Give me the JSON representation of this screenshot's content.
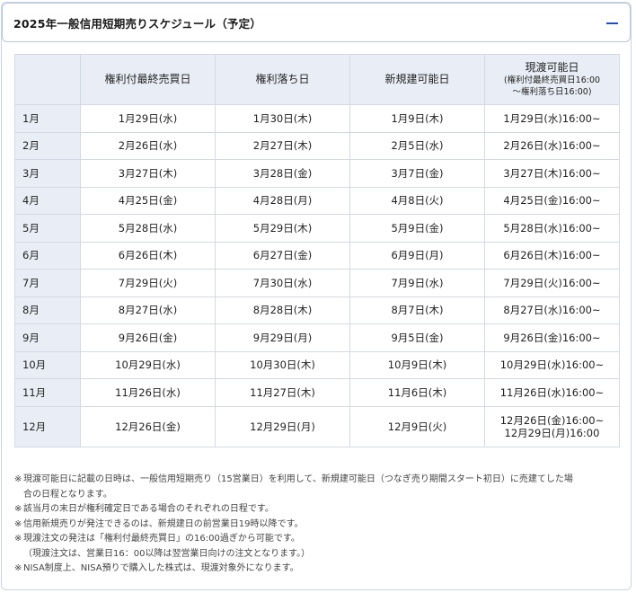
{
  "panel": {
    "title": "2025年一般信用短期売りスケジュール（予定）"
  },
  "table": {
    "headers": [
      {
        "main": "",
        "sub": ""
      },
      {
        "main": "権利付最終売買日",
        "sub": ""
      },
      {
        "main": "権利落ち日",
        "sub": ""
      },
      {
        "main": "新規建可能日",
        "sub": ""
      },
      {
        "main": "現渡可能日",
        "sub1": "(権利付最終売買日16:00",
        "sub2": "〜権利落ち日16:00)"
      }
    ],
    "rows": [
      {
        "month": "1月",
        "c1": "1月29日(水)",
        "c2": "1月30日(木)",
        "c3": "1月9日(木)",
        "c4": "1月29日(水)16:00~"
      },
      {
        "month": "2月",
        "c1": "2月26日(水)",
        "c2": "2月27日(木)",
        "c3": "2月5日(水)",
        "c4": "2月26日(水)16:00~"
      },
      {
        "month": "3月",
        "c1": "3月27日(木)",
        "c2": "3月28日(金)",
        "c3": "3月7日(金)",
        "c4": "3月27日(木)16:00~"
      },
      {
        "month": "4月",
        "c1": "4月25日(金)",
        "c2": "4月28日(月)",
        "c3": "4月8日(火)",
        "c4": "4月25日(金)16:00~"
      },
      {
        "month": "5月",
        "c1": "5月28日(水)",
        "c2": "5月29日(木)",
        "c3": "5月9日(金)",
        "c4": "5月28日(水)16:00~"
      },
      {
        "month": "6月",
        "c1": "6月26日(木)",
        "c2": "6月27日(金)",
        "c3": "6月9日(月)",
        "c4": "6月26日(木)16:00~"
      },
      {
        "month": "7月",
        "c1": "7月29日(火)",
        "c2": "7月30日(水)",
        "c3": "7月9日(水)",
        "c4": "7月29日(火)16:00~"
      },
      {
        "month": "8月",
        "c1": "8月27日(水)",
        "c2": "8月28日(木)",
        "c3": "8月7日(木)",
        "c4": "8月27日(水)16:00~"
      },
      {
        "month": "9月",
        "c1": "9月26日(金)",
        "c2": "9月29日(月)",
        "c3": "9月5日(金)",
        "c4": "9月26日(金)16:00~"
      },
      {
        "month": "10月",
        "c1": "10月29日(水)",
        "c2": "10月30日(木)",
        "c3": "10月9日(木)",
        "c4": "10月29日(水)16:00~"
      },
      {
        "month": "11月",
        "c1": "11月26日(水)",
        "c2": "11月27日(木)",
        "c3": "11月6日(木)",
        "c4": "11月26日(水)16:00~"
      },
      {
        "month": "12月",
        "c1": "12月26日(金)",
        "c2": "12月29日(月)",
        "c3": "12月9日(火)",
        "c4a": "12月26日(金)16:00~",
        "c4b": "12月29日(月)16:00"
      }
    ]
  },
  "notes": {
    "mark": "※",
    "n1a": "現渡可能日に記載の日時は、一般信用短期売り（15営業日）を利用して、新規建可能日（つなぎ売り期間スタート初日）に売建てした場",
    "n1b": "合の日程となります。",
    "n2": "該当月の末日が権利確定日である場合のそれぞれの日程です。",
    "n3": "信用新規売りが発注できるのは、新規建日の前営業日19時以降です。",
    "n4a": "現渡注文の発注は「権利付最終売買日」の16:00過ぎから可能です。",
    "n4b": "（現渡注文は、営業日16：00以降は翌営業日向けの注文となります。）",
    "n5": "NISA制度上、NISA預りで購入した株式は、現渡対象外になります。"
  },
  "colors": {
    "accent": "#1f4fbf",
    "header_bg": "#e9eef6",
    "border": "#d3d9e4"
  },
  "icons": {
    "collapse": "minus-icon"
  }
}
